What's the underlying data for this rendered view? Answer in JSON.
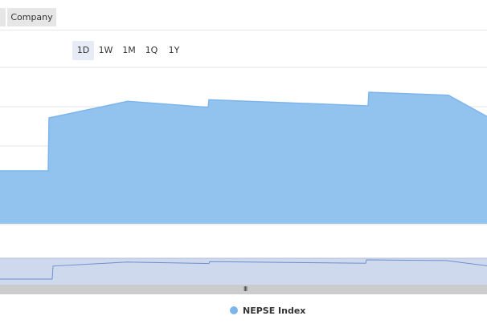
{
  "tabs": {
    "company_label": "Company"
  },
  "range_selector": {
    "buttons": [
      "1D",
      "1W",
      "1M",
      "1Q",
      "1Y"
    ],
    "active": "1D"
  },
  "colors": {
    "series": "#7cb5ec",
    "series_fill": "#92c3ee",
    "navigator_fill": "#cfd9ee",
    "scrollbar": "#cccccc",
    "grid": "#e6e6e6"
  },
  "chart_data": {
    "type": "area",
    "title": "",
    "xlabel": "",
    "ylabel": "",
    "series": [
      {
        "name": "NEPSE Index",
        "x": [
          0,
          1,
          2,
          3,
          4,
          5,
          6,
          7,
          8,
          9
        ],
        "values": [
          0.35,
          0.35,
          0.7,
          0.81,
          0.77,
          0.82,
          0.78,
          0.87,
          0.85,
          0.71
        ]
      }
    ],
    "legend": "bottom",
    "grid": true
  },
  "legend": {
    "label": "NEPSE Index"
  },
  "scrollbar": {
    "grip": "III"
  }
}
